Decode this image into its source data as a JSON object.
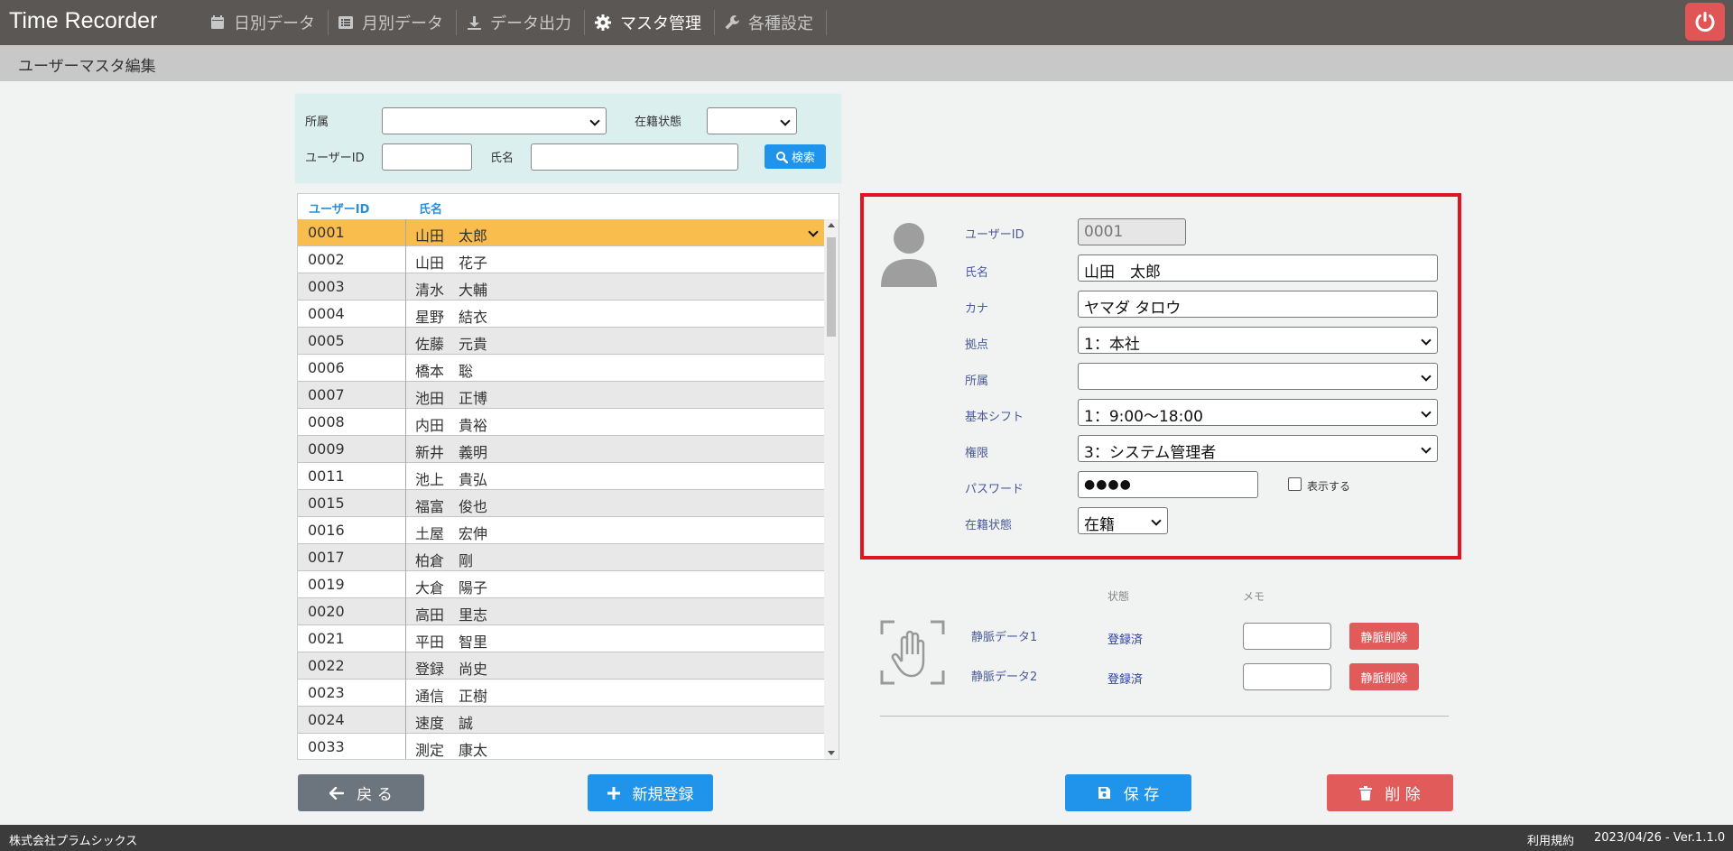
{
  "app": {
    "title": "Time Recorder"
  },
  "nav": [
    {
      "label": "日別データ",
      "icon": "calendar-icon"
    },
    {
      "label": "月別データ",
      "icon": "list-icon"
    },
    {
      "label": "データ出力",
      "icon": "download-icon"
    },
    {
      "label": "マスタ管理",
      "icon": "gear-icon",
      "active": true
    },
    {
      "label": "各種設定",
      "icon": "wrench-icon"
    }
  ],
  "page": {
    "title": "ユーザーマスタ編集"
  },
  "search": {
    "affiliation_label": "所属",
    "status_label": "在籍状態",
    "userid_label": "ユーザーID",
    "name_label": "氏名",
    "button_label": "検索"
  },
  "list": {
    "headers": [
      "ユーザーID",
      "氏名"
    ],
    "selected_index": 0,
    "rows": [
      {
        "id": "0001",
        "name": "山田　太郎"
      },
      {
        "id": "0002",
        "name": "山田　花子"
      },
      {
        "id": "0003",
        "name": "清水　大輔"
      },
      {
        "id": "0004",
        "name": "星野　結衣"
      },
      {
        "id": "0005",
        "name": "佐藤　元貴"
      },
      {
        "id": "0006",
        "name": "橋本　聡"
      },
      {
        "id": "0007",
        "name": "池田　正博"
      },
      {
        "id": "0008",
        "name": "内田　貴裕"
      },
      {
        "id": "0009",
        "name": "新井　義明"
      },
      {
        "id": "0011",
        "name": "池上　貴弘"
      },
      {
        "id": "0015",
        "name": "福富　俊也"
      },
      {
        "id": "0016",
        "name": "土屋　宏伸"
      },
      {
        "id": "0017",
        "name": "柏倉　剛"
      },
      {
        "id": "0019",
        "name": "大倉　陽子"
      },
      {
        "id": "0020",
        "name": "高田　里志"
      },
      {
        "id": "0021",
        "name": "平田　智里"
      },
      {
        "id": "0022",
        "name": "登録　尚史"
      },
      {
        "id": "0023",
        "name": "通信　正樹"
      },
      {
        "id": "0024",
        "name": "速度　誠"
      },
      {
        "id": "0033",
        "name": "測定　康太"
      }
    ]
  },
  "detail": {
    "userid_label": "ユーザーID",
    "userid_value": "0001",
    "name_label": "氏名",
    "name_value": "山田　太郎",
    "kana_label": "カナ",
    "kana_value": "ヤマダ タロウ",
    "base_label": "拠点",
    "base_value": "1：本社",
    "affiliation_label": "所属",
    "affiliation_value": "",
    "shift_label": "基本シフト",
    "shift_value": "1：9:00〜18:00",
    "role_label": "権限",
    "role_value": "3：システム管理者",
    "password_label": "パスワード",
    "password_value": "●●●●",
    "show_password_label": "表示する",
    "status_label": "在籍状態",
    "status_value": "在籍"
  },
  "vein": {
    "status_header": "状態",
    "memo_header": "メモ",
    "rows": [
      {
        "label": "静脈データ1",
        "status": "登録済",
        "delete_label": "静脈削除"
      },
      {
        "label": "静脈データ2",
        "status": "登録済",
        "delete_label": "静脈削除"
      }
    ]
  },
  "buttons": {
    "back": "戻 る",
    "new": "新規登録",
    "save": "保 存",
    "delete": "削 除"
  },
  "footer": {
    "company": "株式会社プラムシックス",
    "terms": "利用規約",
    "version": "2023/04/26 - Ver.1.1.0"
  },
  "colors": {
    "header": "#5b5754",
    "accent": "#1f94ea",
    "danger": "#e15b5b",
    "selected_row": "#f8bd4c",
    "highlight_border": "#e2141f"
  }
}
